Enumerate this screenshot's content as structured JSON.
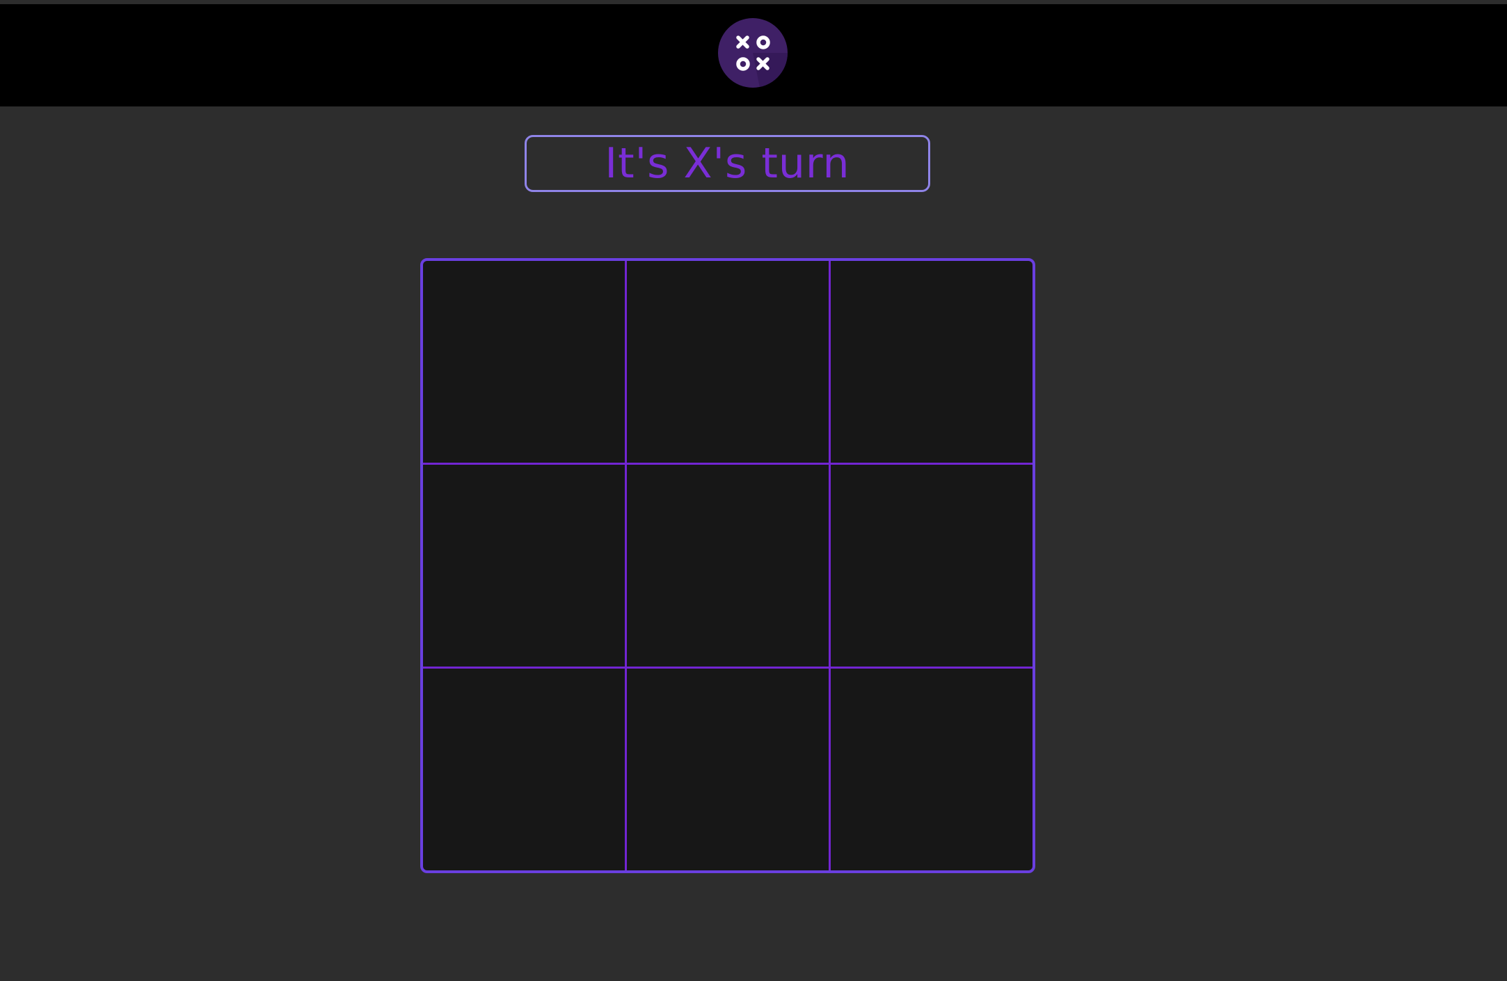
{
  "header": {
    "logo_icon": "tic-tac-toe-xo-logo-icon"
  },
  "status": {
    "text": "It's X's turn"
  },
  "board": {
    "cells": [
      "",
      "",
      "",
      "",
      "",
      "",
      "",
      "",
      ""
    ]
  },
  "colors": {
    "background": "#2d2d2d",
    "header": "#000000",
    "accent": "#7225d2",
    "status_border": "#8f84e8",
    "status_text": "#7a2ed6",
    "cell": "#171717",
    "logo_circle": "#3f2066"
  }
}
